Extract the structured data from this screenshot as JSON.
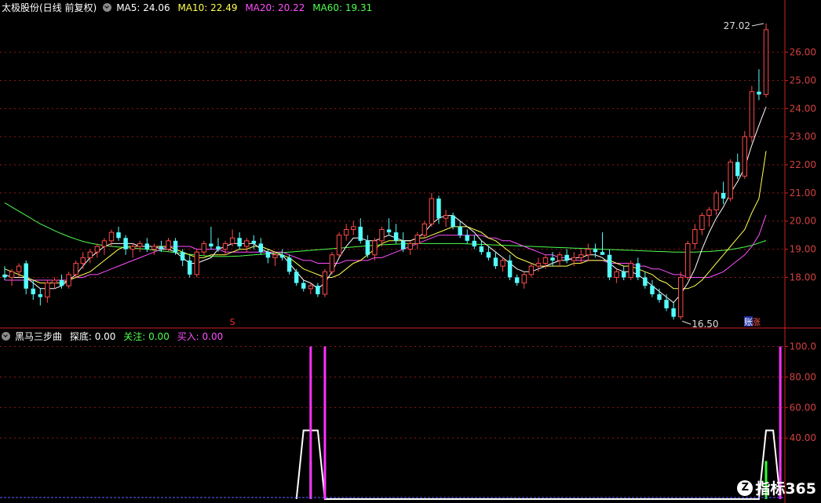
{
  "header": {
    "title": "太极股份(日线 前复权)",
    "ma5": "MA5: 24.06",
    "ma10": "MA10: 22.49",
    "ma20": "MA20: 20.22",
    "ma60": "MA60: 19.31"
  },
  "indicator_header": {
    "name": "黑马三步曲",
    "tandi": "探底: 0.00",
    "guanzhu": "关注: 0.00",
    "mairu": "买入: 0.00"
  },
  "annotations": {
    "high_label": "27.02",
    "low_label": "16.50",
    "marker_s": "S",
    "event_badge": "账",
    "event_badge2": "涨"
  },
  "colors": {
    "up": "#ff4a4a",
    "down": "#54ffff",
    "ma5": "#ffffff",
    "ma10": "#ffff4f",
    "ma20": "#ff4fff",
    "ma60": "#4fff4f",
    "grid": "#8b1a1a",
    "axis": "#d02020",
    "axis_text": "#d04040"
  },
  "logo": {
    "mark": "Z",
    "text": "指标365"
  },
  "chart_data": [
    {
      "type": "candlestick",
      "ylim": [
        16.2,
        27.3
      ],
      "yticks": [
        "18.00",
        "19.00",
        "20.00",
        "21.00",
        "22.00",
        "23.00",
        "24.00",
        "25.00",
        "26.00"
      ],
      "ohlc": [
        [
          18.1,
          18.4,
          17.9,
          18.0
        ],
        [
          18.0,
          18.3,
          17.7,
          18.2
        ],
        [
          18.2,
          18.5,
          18.0,
          18.4
        ],
        [
          18.5,
          18.6,
          17.4,
          17.6
        ],
        [
          17.6,
          17.9,
          17.2,
          17.4
        ],
        [
          17.4,
          17.6,
          17.0,
          17.3
        ],
        [
          17.3,
          17.9,
          17.1,
          17.8
        ],
        [
          17.8,
          18.0,
          17.6,
          17.9
        ],
        [
          17.9,
          18.1,
          17.6,
          17.7
        ],
        [
          17.7,
          18.2,
          17.6,
          18.1
        ],
        [
          18.1,
          18.6,
          18.0,
          18.5
        ],
        [
          18.5,
          18.9,
          18.3,
          18.7
        ],
        [
          18.7,
          19.0,
          18.5,
          18.9
        ],
        [
          18.9,
          19.2,
          18.7,
          19.1
        ],
        [
          19.1,
          19.4,
          18.8,
          19.3
        ],
        [
          19.3,
          19.7,
          19.1,
          19.6
        ],
        [
          19.6,
          19.8,
          19.3,
          19.4
        ],
        [
          19.4,
          19.5,
          18.8,
          19.0
        ],
        [
          19.0,
          19.2,
          18.7,
          19.1
        ],
        [
          19.1,
          19.3,
          18.9,
          19.2
        ],
        [
          19.2,
          19.4,
          18.9,
          19.0
        ],
        [
          19.0,
          19.2,
          18.8,
          19.1
        ],
        [
          19.1,
          19.3,
          18.9,
          19.0
        ],
        [
          19.0,
          19.4,
          18.9,
          19.3
        ],
        [
          19.3,
          19.4,
          18.8,
          18.9
        ],
        [
          18.9,
          19.0,
          18.4,
          18.6
        ],
        [
          18.6,
          18.8,
          18.0,
          18.1
        ],
        [
          18.1,
          19.0,
          18.0,
          18.9
        ],
        [
          18.9,
          19.3,
          18.8,
          19.2
        ],
        [
          19.2,
          19.8,
          19.0,
          19.1
        ],
        [
          19.1,
          19.4,
          18.9,
          19.0
        ],
        [
          19.0,
          19.3,
          18.8,
          19.2
        ],
        [
          19.2,
          19.7,
          19.1,
          19.4
        ],
        [
          19.4,
          19.6,
          19.0,
          19.1
        ],
        [
          19.1,
          19.4,
          18.9,
          19.3
        ],
        [
          19.3,
          19.5,
          19.0,
          19.2
        ],
        [
          19.2,
          19.4,
          18.8,
          18.9
        ],
        [
          18.9,
          19.0,
          18.5,
          18.7
        ],
        [
          18.7,
          18.9,
          18.4,
          18.8
        ],
        [
          18.8,
          19.0,
          18.6,
          18.7
        ],
        [
          18.7,
          18.8,
          18.1,
          18.2
        ],
        [
          18.2,
          18.3,
          17.7,
          17.8
        ],
        [
          17.8,
          17.9,
          17.5,
          17.6
        ],
        [
          17.6,
          17.8,
          17.4,
          17.7
        ],
        [
          17.7,
          17.8,
          17.3,
          17.4
        ],
        [
          17.4,
          18.3,
          17.3,
          18.2
        ],
        [
          18.2,
          18.9,
          18.1,
          18.8
        ],
        [
          18.8,
          19.6,
          18.7,
          19.5
        ],
        [
          19.5,
          19.9,
          19.3,
          19.7
        ],
        [
          19.7,
          20.0,
          19.5,
          19.8
        ],
        [
          19.8,
          20.1,
          19.2,
          19.3
        ],
        [
          19.3,
          19.5,
          18.7,
          18.8
        ],
        [
          18.8,
          19.4,
          18.6,
          19.3
        ],
        [
          19.3,
          19.8,
          19.1,
          19.7
        ],
        [
          19.7,
          20.1,
          19.5,
          19.6
        ],
        [
          19.6,
          19.9,
          19.2,
          19.3
        ],
        [
          19.3,
          19.6,
          18.9,
          19.0
        ],
        [
          19.0,
          19.3,
          18.8,
          19.2
        ],
        [
          19.2,
          19.6,
          19.0,
          19.5
        ],
        [
          19.5,
          20.0,
          19.4,
          19.9
        ],
        [
          19.9,
          21.0,
          19.8,
          20.8
        ],
        [
          20.8,
          20.9,
          19.9,
          20.1
        ],
        [
          20.1,
          20.4,
          19.8,
          20.2
        ],
        [
          20.2,
          20.3,
          19.7,
          19.8
        ],
        [
          19.8,
          20.0,
          19.4,
          19.5
        ],
        [
          19.5,
          19.7,
          19.2,
          19.3
        ],
        [
          19.3,
          19.5,
          19.0,
          19.1
        ],
        [
          19.1,
          19.3,
          18.8,
          18.9
        ],
        [
          18.9,
          19.1,
          18.6,
          18.7
        ],
        [
          18.7,
          18.9,
          18.3,
          18.4
        ],
        [
          18.4,
          18.7,
          18.2,
          18.6
        ],
        [
          18.6,
          18.8,
          17.9,
          18.0
        ],
        [
          18.0,
          18.1,
          17.7,
          17.8
        ],
        [
          17.8,
          18.2,
          17.6,
          18.1
        ],
        [
          18.1,
          18.5,
          18.0,
          18.4
        ],
        [
          18.4,
          18.7,
          18.2,
          18.5
        ],
        [
          18.5,
          18.8,
          18.3,
          18.7
        ],
        [
          18.7,
          18.9,
          18.4,
          18.6
        ],
        [
          18.6,
          18.9,
          18.4,
          18.8
        ],
        [
          18.8,
          19.0,
          18.5,
          18.6
        ],
        [
          18.6,
          18.9,
          18.4,
          18.7
        ],
        [
          18.7,
          19.0,
          18.5,
          18.8
        ],
        [
          18.8,
          19.2,
          18.6,
          19.0
        ],
        [
          19.0,
          19.2,
          18.7,
          18.9
        ],
        [
          18.9,
          19.6,
          18.8,
          18.8
        ],
        [
          18.8,
          19.0,
          17.9,
          18.0
        ],
        [
          18.0,
          18.3,
          17.8,
          18.2
        ],
        [
          18.2,
          18.4,
          17.9,
          18.0
        ],
        [
          18.0,
          18.6,
          17.9,
          18.5
        ],
        [
          18.5,
          18.7,
          17.9,
          18.0
        ],
        [
          18.0,
          18.2,
          17.6,
          17.7
        ],
        [
          17.7,
          17.9,
          17.3,
          17.4
        ],
        [
          17.4,
          17.6,
          17.1,
          17.2
        ],
        [
          17.2,
          17.4,
          16.8,
          16.9
        ],
        [
          16.9,
          17.1,
          16.5,
          16.6
        ],
        [
          16.6,
          18.2,
          16.5,
          18.0
        ],
        [
          18.0,
          19.3,
          17.9,
          19.2
        ],
        [
          19.2,
          19.9,
          19.0,
          19.7
        ],
        [
          19.7,
          20.3,
          19.5,
          20.2
        ],
        [
          20.2,
          20.5,
          19.8,
          20.4
        ],
        [
          20.4,
          21.1,
          20.2,
          21.0
        ],
        [
          21.0,
          21.4,
          20.6,
          20.8
        ],
        [
          20.8,
          22.2,
          20.7,
          22.1
        ],
        [
          22.1,
          22.4,
          21.5,
          21.6
        ],
        [
          21.6,
          23.2,
          21.5,
          23.0
        ],
        [
          23.0,
          24.8,
          22.8,
          24.6
        ],
        [
          24.6,
          25.4,
          24.3,
          24.5
        ],
        [
          24.5,
          27.02,
          24.4,
          26.8
        ]
      ],
      "ma5": [
        18.1,
        18.0,
        18.0,
        18.0,
        17.8,
        17.6,
        17.6,
        17.6,
        17.7,
        17.9,
        18.1,
        18.4,
        18.7,
        18.9,
        19.1,
        19.2,
        19.2,
        19.2,
        19.2,
        19.1,
        19.1,
        19.1,
        19.0,
        19.0,
        18.9,
        18.7,
        18.5,
        18.5,
        18.6,
        18.7,
        19.0,
        19.1,
        19.2,
        19.2,
        19.2,
        19.2,
        19.0,
        18.9,
        18.8,
        18.8,
        18.5,
        18.2,
        17.9,
        17.8,
        17.6,
        17.8,
        18.2,
        18.7,
        19.1,
        19.4,
        19.4,
        19.3,
        19.3,
        19.4,
        19.5,
        19.4,
        19.3,
        19.3,
        19.4,
        19.6,
        19.9,
        20.1,
        20.2,
        20.2,
        20.0,
        19.8,
        19.6,
        19.3,
        19.1,
        18.9,
        18.7,
        18.5,
        18.3,
        18.2,
        18.2,
        18.3,
        18.4,
        18.5,
        18.6,
        18.6,
        18.7,
        18.7,
        18.8,
        18.8,
        18.7,
        18.5,
        18.3,
        18.2,
        18.2,
        18.1,
        17.9,
        17.7,
        17.5,
        17.3,
        17.1,
        17.4,
        17.8,
        18.3,
        19.0,
        19.6,
        20.1,
        20.5,
        21.0,
        21.4,
        21.9,
        22.7,
        23.4,
        24.06
      ],
      "ma10": [
        18.3,
        18.2,
        18.1,
        18.0,
        17.9,
        17.8,
        17.8,
        17.8,
        17.8,
        17.9,
        18.0,
        18.1,
        18.2,
        18.4,
        18.6,
        18.8,
        19.0,
        19.1,
        19.1,
        19.1,
        19.1,
        19.1,
        19.1,
        19.1,
        19.0,
        18.9,
        18.8,
        18.7,
        18.7,
        18.8,
        18.8,
        18.8,
        18.9,
        19.0,
        19.0,
        19.1,
        19.1,
        19.0,
        18.9,
        18.8,
        18.7,
        18.5,
        18.3,
        18.2,
        18.1,
        18.0,
        18.0,
        18.1,
        18.3,
        18.5,
        18.6,
        18.8,
        19.0,
        19.2,
        19.3,
        19.3,
        19.3,
        19.3,
        19.4,
        19.4,
        19.5,
        19.6,
        19.7,
        19.8,
        19.8,
        19.8,
        19.7,
        19.6,
        19.4,
        19.3,
        19.1,
        18.9,
        18.7,
        18.6,
        18.5,
        18.4,
        18.4,
        18.4,
        18.4,
        18.4,
        18.5,
        18.5,
        18.6,
        18.6,
        18.6,
        18.6,
        18.5,
        18.4,
        18.4,
        18.3,
        18.2,
        18.1,
        17.9,
        17.8,
        17.6,
        17.6,
        17.6,
        17.7,
        17.9,
        18.2,
        18.5,
        18.8,
        19.1,
        19.4,
        19.7,
        20.3,
        20.8,
        22.49
      ],
      "ma20": [
        17.9,
        17.9,
        17.9,
        17.9,
        17.9,
        17.9,
        17.9,
        17.9,
        17.9,
        17.9,
        18.0,
        18.0,
        18.1,
        18.1,
        18.2,
        18.3,
        18.4,
        18.5,
        18.6,
        18.7,
        18.8,
        18.9,
        19.0,
        19.1,
        19.1,
        19.1,
        19.1,
        19.0,
        19.0,
        19.0,
        19.0,
        18.9,
        18.9,
        18.9,
        18.9,
        18.9,
        18.9,
        18.9,
        18.9,
        18.9,
        18.8,
        18.7,
        18.6,
        18.6,
        18.5,
        18.5,
        18.5,
        18.5,
        18.6,
        18.6,
        18.6,
        18.6,
        18.7,
        18.7,
        18.8,
        18.9,
        19.0,
        19.1,
        19.2,
        19.3,
        19.4,
        19.5,
        19.5,
        19.5,
        19.5,
        19.5,
        19.5,
        19.5,
        19.4,
        19.4,
        19.3,
        19.3,
        19.2,
        19.1,
        19.0,
        18.9,
        18.8,
        18.8,
        18.7,
        18.7,
        18.6,
        18.6,
        18.6,
        18.6,
        18.6,
        18.5,
        18.5,
        18.5,
        18.5,
        18.4,
        18.4,
        18.3,
        18.3,
        18.2,
        18.1,
        18.1,
        18.0,
        18.0,
        18.0,
        18.0,
        18.1,
        18.2,
        18.4,
        18.6,
        18.8,
        19.1,
        19.5,
        20.22
      ],
      "ma60": [
        20.65,
        20.5,
        20.35,
        20.2,
        20.05,
        19.9,
        19.78,
        19.66,
        19.55,
        19.45,
        19.36,
        19.28,
        19.22,
        19.17,
        19.13,
        19.1,
        19.08,
        19.06,
        19.04,
        19.02,
        19.0,
        18.97,
        18.94,
        18.91,
        18.88,
        18.85,
        18.82,
        18.79,
        18.77,
        18.75,
        18.74,
        18.74,
        18.75,
        18.76,
        18.78,
        18.8,
        18.82,
        18.84,
        18.86,
        18.88,
        18.9,
        18.92,
        18.94,
        18.96,
        18.98,
        19.0,
        19.02,
        19.04,
        19.06,
        19.08,
        19.1,
        19.12,
        19.14,
        19.16,
        19.17,
        19.18,
        19.19,
        19.2,
        19.2,
        19.2,
        19.2,
        19.2,
        19.2,
        19.2,
        19.2,
        19.19,
        19.18,
        19.17,
        19.16,
        19.15,
        19.14,
        19.13,
        19.12,
        19.11,
        19.1,
        19.09,
        19.08,
        19.07,
        19.06,
        19.05,
        19.04,
        19.03,
        19.02,
        19.01,
        19.0,
        18.99,
        18.98,
        18.97,
        18.96,
        18.95,
        18.94,
        18.93,
        18.92,
        18.91,
        18.9,
        18.9,
        18.9,
        18.9,
        18.91,
        18.92,
        18.94,
        18.96,
        18.99,
        19.03,
        19.08,
        19.14,
        19.22,
        19.31
      ]
    },
    {
      "type": "line",
      "ylim": [
        0,
        108
      ],
      "yticks": [
        "100.0",
        "80.00",
        "60.00",
        "40.00"
      ],
      "series": [
        {
          "name": "探底",
          "points": [
            [
              41,
              0
            ],
            [
              42,
              45
            ],
            [
              43,
              45
            ],
            [
              44,
              45
            ],
            [
              45,
              0
            ],
            [
              106,
              0
            ],
            [
              107,
              45
            ],
            [
              108,
              45
            ],
            [
              109,
              0
            ]
          ]
        },
        {
          "name": "关注",
          "bars": [
            [
              43,
              25
            ],
            [
              45,
              25
            ],
            [
              107,
              25
            ]
          ]
        },
        {
          "name": "买入",
          "bars": [
            [
              43,
              100
            ],
            [
              45,
              100
            ],
            [
              109,
              100
            ]
          ]
        }
      ]
    }
  ]
}
